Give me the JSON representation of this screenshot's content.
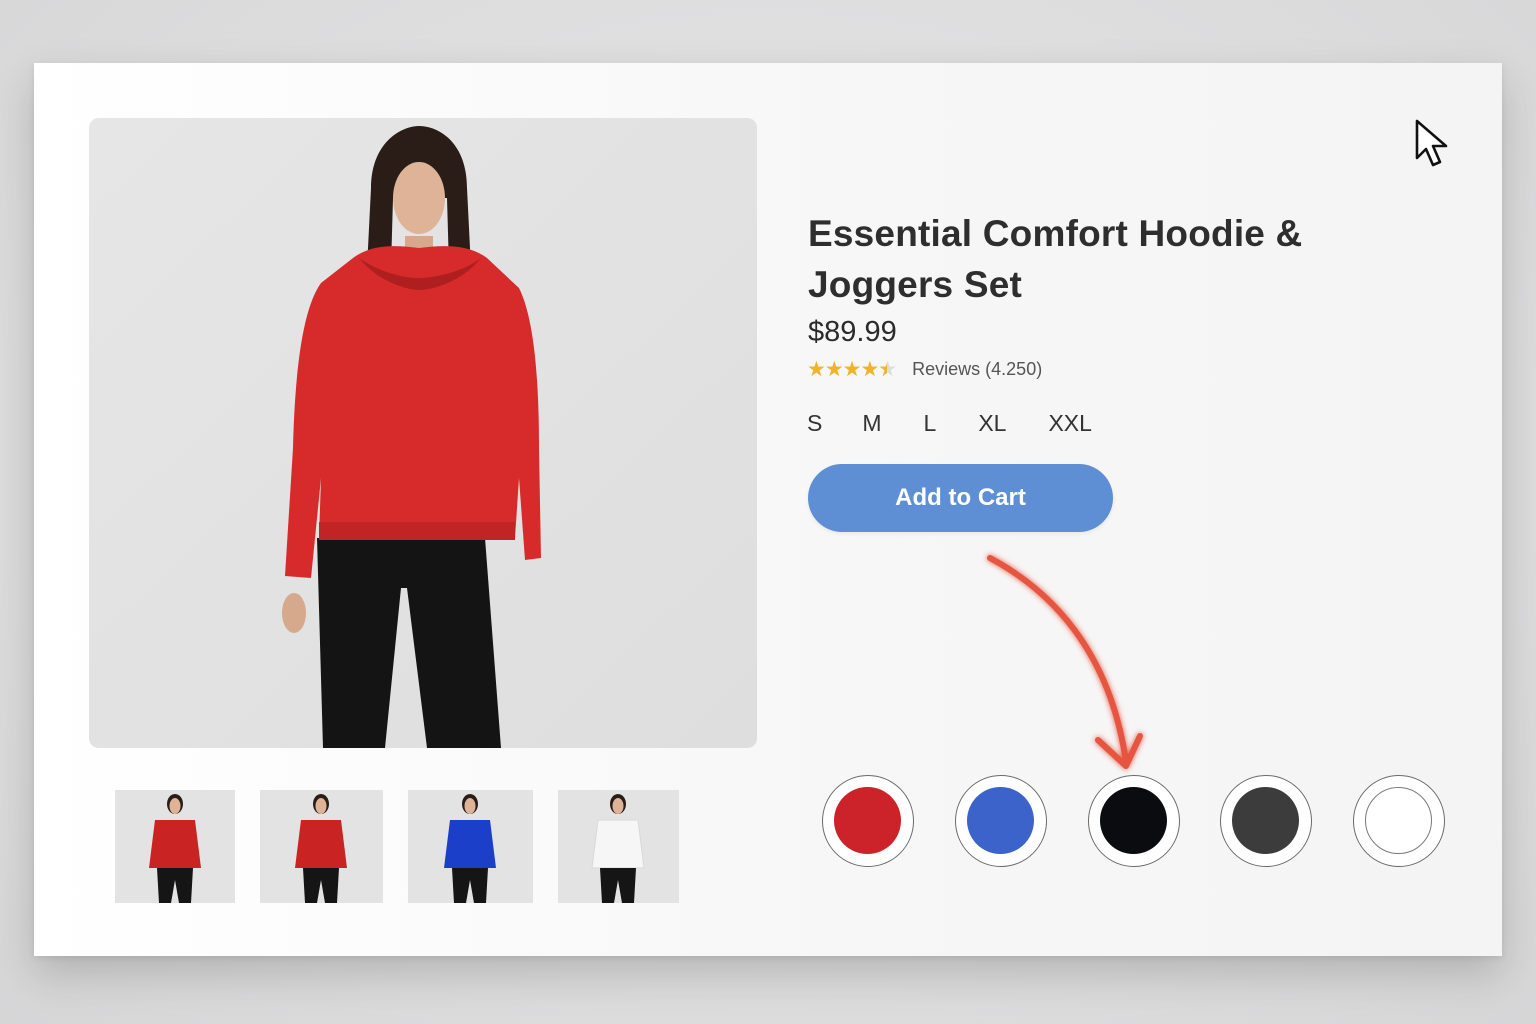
{
  "product": {
    "title": "Essential Comfort Hoodie & Joggers Set",
    "price": "$89.99",
    "rating": {
      "stars": "★★★★★",
      "value_out_of_5": 4.5,
      "reviews_label": "Reviews (4.250)"
    },
    "sizes": [
      "S",
      "M",
      "L",
      "XL",
      "XXL"
    ],
    "add_to_cart_label": "Add to Cart",
    "accent_color": "#5e8fd4"
  },
  "gallery": {
    "main_image": {
      "top_color": "#d72b2b",
      "bottom_color": "#141414"
    },
    "thumbnails": [
      {
        "top_color": "#c92323",
        "bottom_color": "#151515"
      },
      {
        "top_color": "#c92323",
        "bottom_color": "#151515"
      },
      {
        "top_color": "#1c3fc9",
        "bottom_color": "#151515"
      },
      {
        "top_color": "#f6f6f6",
        "bottom_color": "#151515"
      }
    ]
  },
  "color_swatches": [
    {
      "color": "#cc2229"
    },
    {
      "color": "#3b63c9"
    },
    {
      "color": "#0b0c10"
    },
    {
      "color": "#3c3c3c"
    },
    {
      "color": "#ffffff"
    }
  ],
  "annotation": {
    "icon": "red-curved-arrow-icon",
    "color": "#e55441"
  },
  "cursor": {
    "icon": "mouse-pointer-icon"
  }
}
